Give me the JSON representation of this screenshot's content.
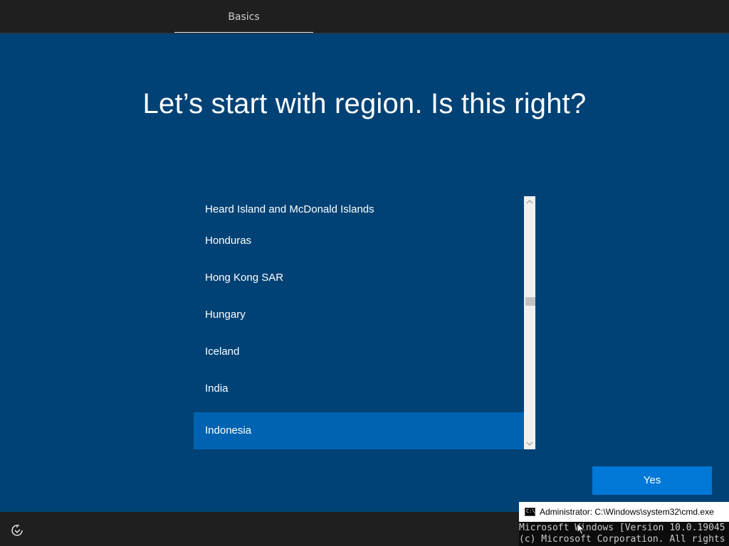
{
  "header": {
    "tabs": [
      {
        "label": "Basics",
        "active": true
      }
    ]
  },
  "main": {
    "title": "Let’s start with region. Is this right?",
    "region_list": {
      "items": [
        "Heard Island and McDonald Islands",
        "Honduras",
        "Hong Kong SAR",
        "Hungary",
        "Iceland",
        "India",
        "Indonesia"
      ],
      "selected": "Indonesia"
    },
    "yes_label": "Yes"
  },
  "footer": {
    "accessibility_icon": "ease-of-access-icon"
  },
  "cmd_window": {
    "title": "Administrator: C:\\Windows\\system32\\cmd.exe",
    "icon_text": "C:\\",
    "line1": "Microsoft Windows [Version 10.0.19045",
    "line2": "(c) Microsoft Corporation. All rights"
  },
  "colors": {
    "background": "#004275",
    "selected_item": "#0063b1",
    "button": "#0078d7",
    "bars": "#1f1f1f"
  }
}
